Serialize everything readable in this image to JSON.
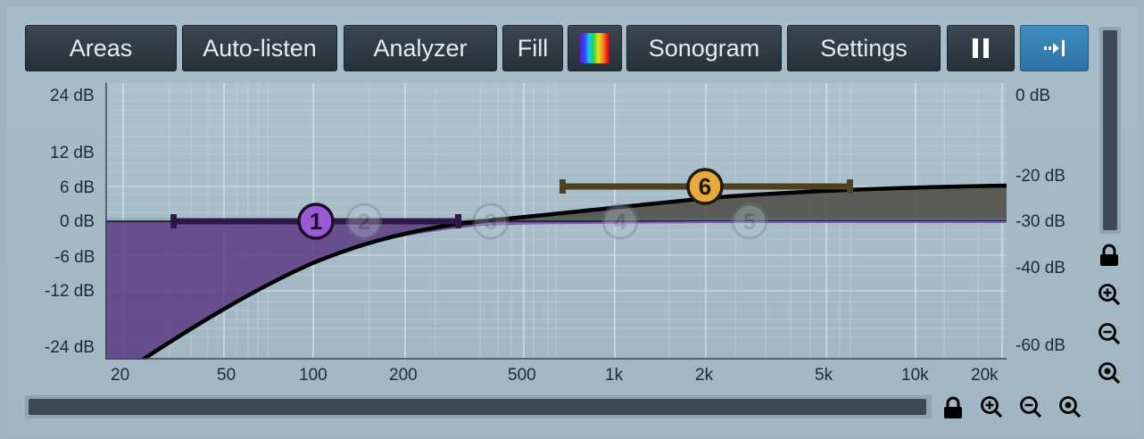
{
  "toolbar": {
    "areas": "Areas",
    "auto_listen": "Auto-listen",
    "analyzer": "Analyzer",
    "fill": "Fill",
    "sonogram": "Sonogram",
    "settings": "Settings",
    "palette_icon": "spectrum-palette-icon",
    "pause_icon": "pause-icon",
    "follow_icon": "follow-right-icon"
  },
  "gain_axis": [
    "24 dB",
    "12 dB",
    "6 dB",
    "0 dB",
    "-6 dB",
    "-12 dB",
    "-24 dB"
  ],
  "level_axis": [
    "0 dB",
    "-20 dB",
    "-30 dB",
    "-40 dB",
    "-60 dB"
  ],
  "freq_axis": [
    "20",
    "50",
    "100",
    "200",
    "500",
    "1k",
    "2k",
    "5k",
    "10k",
    "20k"
  ],
  "bands": [
    {
      "label": "1",
      "active": true,
      "color": "#9a5ad6"
    },
    {
      "label": "2",
      "active": false
    },
    {
      "label": "3",
      "active": false
    },
    {
      "label": "4",
      "active": false
    },
    {
      "label": "5",
      "active": false
    },
    {
      "label": "6",
      "active": true,
      "color": "#e6a93a"
    }
  ],
  "colors": {
    "background": "#a3b8c5",
    "band1_fill": "#5c3b84",
    "band6_fill": "#4c4a43",
    "curve": "#000000",
    "button_active": "#3380b6"
  },
  "side_icons": [
    "lock-icon",
    "zoom-in-icon",
    "zoom-out-icon",
    "zoom-reset-icon"
  ],
  "bottom_icons": [
    "lock-icon",
    "zoom-in-icon",
    "zoom-out-icon",
    "zoom-reset-icon"
  ]
}
